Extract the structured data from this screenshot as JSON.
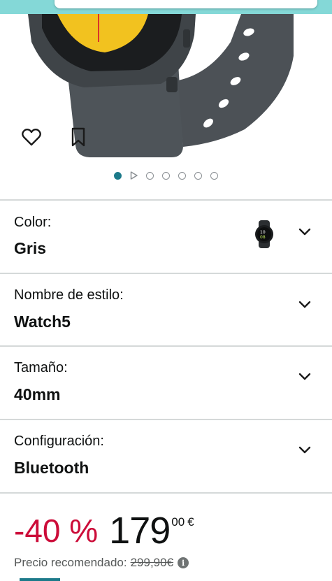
{
  "gallery": {
    "image_alt": "Samsung Galaxy Watch5 gris",
    "slide_count": 7,
    "active_slide": 1
  },
  "options": [
    {
      "label": "Color:",
      "value": "Gris"
    },
    {
      "label": "Nombre de estilo:",
      "value": "Watch5"
    },
    {
      "label": "Tamaño:",
      "value": "40mm"
    },
    {
      "label": "Configuración:",
      "value": "Bluetooth"
    }
  ],
  "price": {
    "discount": "-40 %",
    "whole": "179",
    "fraction": "00",
    "currency": "€"
  },
  "recommended": {
    "label": "Precio recomendado:",
    "price": "299,90€"
  },
  "colors": {
    "accent": "#1c7a8a",
    "discount": "#cc0c39",
    "top_strip": "#84d8d7"
  }
}
